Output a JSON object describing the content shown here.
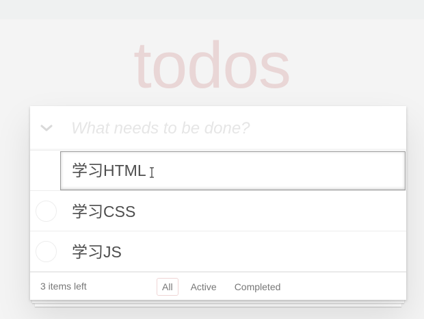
{
  "app": {
    "title": "todos"
  },
  "new_todo": {
    "placeholder": "What needs to be done?"
  },
  "todos": [
    {
      "label": "学习HTML",
      "completed": false,
      "editing": true
    },
    {
      "label": "学习CSS",
      "completed": false,
      "editing": false
    },
    {
      "label": "学习JS",
      "completed": false,
      "editing": false
    }
  ],
  "footer": {
    "items_left": "3 items left",
    "filters": [
      {
        "label": "All",
        "selected": true
      },
      {
        "label": "Active",
        "selected": false
      },
      {
        "label": "Completed",
        "selected": false
      }
    ]
  },
  "colors": {
    "title": "#efd5d5",
    "text": "#4d4d4d",
    "muted": "#777777",
    "filter_border": "#e8c9c9"
  },
  "icons": {
    "toggle_all": "chevron-down-icon",
    "cursor": "text-cursor-icon"
  }
}
